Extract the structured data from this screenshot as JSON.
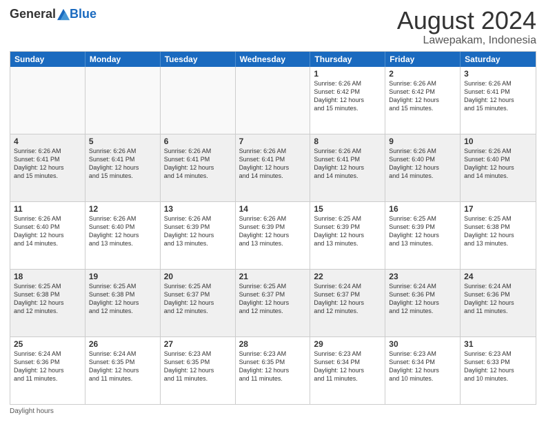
{
  "header": {
    "logo_general": "General",
    "logo_blue": "Blue",
    "month_title": "August 2024",
    "location": "Lawepakam, Indonesia"
  },
  "days_of_week": [
    "Sunday",
    "Monday",
    "Tuesday",
    "Wednesday",
    "Thursday",
    "Friday",
    "Saturday"
  ],
  "footer_note": "Daylight hours",
  "weeks": [
    [
      {
        "day": "",
        "info": ""
      },
      {
        "day": "",
        "info": ""
      },
      {
        "day": "",
        "info": ""
      },
      {
        "day": "",
        "info": ""
      },
      {
        "day": "1",
        "info": "Sunrise: 6:26 AM\nSunset: 6:42 PM\nDaylight: 12 hours\nand 15 minutes."
      },
      {
        "day": "2",
        "info": "Sunrise: 6:26 AM\nSunset: 6:42 PM\nDaylight: 12 hours\nand 15 minutes."
      },
      {
        "day": "3",
        "info": "Sunrise: 6:26 AM\nSunset: 6:41 PM\nDaylight: 12 hours\nand 15 minutes."
      }
    ],
    [
      {
        "day": "4",
        "info": "Sunrise: 6:26 AM\nSunset: 6:41 PM\nDaylight: 12 hours\nand 15 minutes."
      },
      {
        "day": "5",
        "info": "Sunrise: 6:26 AM\nSunset: 6:41 PM\nDaylight: 12 hours\nand 15 minutes."
      },
      {
        "day": "6",
        "info": "Sunrise: 6:26 AM\nSunset: 6:41 PM\nDaylight: 12 hours\nand 14 minutes."
      },
      {
        "day": "7",
        "info": "Sunrise: 6:26 AM\nSunset: 6:41 PM\nDaylight: 12 hours\nand 14 minutes."
      },
      {
        "day": "8",
        "info": "Sunrise: 6:26 AM\nSunset: 6:41 PM\nDaylight: 12 hours\nand 14 minutes."
      },
      {
        "day": "9",
        "info": "Sunrise: 6:26 AM\nSunset: 6:40 PM\nDaylight: 12 hours\nand 14 minutes."
      },
      {
        "day": "10",
        "info": "Sunrise: 6:26 AM\nSunset: 6:40 PM\nDaylight: 12 hours\nand 14 minutes."
      }
    ],
    [
      {
        "day": "11",
        "info": "Sunrise: 6:26 AM\nSunset: 6:40 PM\nDaylight: 12 hours\nand 14 minutes."
      },
      {
        "day": "12",
        "info": "Sunrise: 6:26 AM\nSunset: 6:40 PM\nDaylight: 12 hours\nand 13 minutes."
      },
      {
        "day": "13",
        "info": "Sunrise: 6:26 AM\nSunset: 6:39 PM\nDaylight: 12 hours\nand 13 minutes."
      },
      {
        "day": "14",
        "info": "Sunrise: 6:26 AM\nSunset: 6:39 PM\nDaylight: 12 hours\nand 13 minutes."
      },
      {
        "day": "15",
        "info": "Sunrise: 6:25 AM\nSunset: 6:39 PM\nDaylight: 12 hours\nand 13 minutes."
      },
      {
        "day": "16",
        "info": "Sunrise: 6:25 AM\nSunset: 6:39 PM\nDaylight: 12 hours\nand 13 minutes."
      },
      {
        "day": "17",
        "info": "Sunrise: 6:25 AM\nSunset: 6:38 PM\nDaylight: 12 hours\nand 13 minutes."
      }
    ],
    [
      {
        "day": "18",
        "info": "Sunrise: 6:25 AM\nSunset: 6:38 PM\nDaylight: 12 hours\nand 12 minutes."
      },
      {
        "day": "19",
        "info": "Sunrise: 6:25 AM\nSunset: 6:38 PM\nDaylight: 12 hours\nand 12 minutes."
      },
      {
        "day": "20",
        "info": "Sunrise: 6:25 AM\nSunset: 6:37 PM\nDaylight: 12 hours\nand 12 minutes."
      },
      {
        "day": "21",
        "info": "Sunrise: 6:25 AM\nSunset: 6:37 PM\nDaylight: 12 hours\nand 12 minutes."
      },
      {
        "day": "22",
        "info": "Sunrise: 6:24 AM\nSunset: 6:37 PM\nDaylight: 12 hours\nand 12 minutes."
      },
      {
        "day": "23",
        "info": "Sunrise: 6:24 AM\nSunset: 6:36 PM\nDaylight: 12 hours\nand 12 minutes."
      },
      {
        "day": "24",
        "info": "Sunrise: 6:24 AM\nSunset: 6:36 PM\nDaylight: 12 hours\nand 11 minutes."
      }
    ],
    [
      {
        "day": "25",
        "info": "Sunrise: 6:24 AM\nSunset: 6:36 PM\nDaylight: 12 hours\nand 11 minutes."
      },
      {
        "day": "26",
        "info": "Sunrise: 6:24 AM\nSunset: 6:35 PM\nDaylight: 12 hours\nand 11 minutes."
      },
      {
        "day": "27",
        "info": "Sunrise: 6:23 AM\nSunset: 6:35 PM\nDaylight: 12 hours\nand 11 minutes."
      },
      {
        "day": "28",
        "info": "Sunrise: 6:23 AM\nSunset: 6:35 PM\nDaylight: 12 hours\nand 11 minutes."
      },
      {
        "day": "29",
        "info": "Sunrise: 6:23 AM\nSunset: 6:34 PM\nDaylight: 12 hours\nand 11 minutes."
      },
      {
        "day": "30",
        "info": "Sunrise: 6:23 AM\nSunset: 6:34 PM\nDaylight: 12 hours\nand 10 minutes."
      },
      {
        "day": "31",
        "info": "Sunrise: 6:23 AM\nSunset: 6:33 PM\nDaylight: 12 hours\nand 10 minutes."
      }
    ]
  ]
}
